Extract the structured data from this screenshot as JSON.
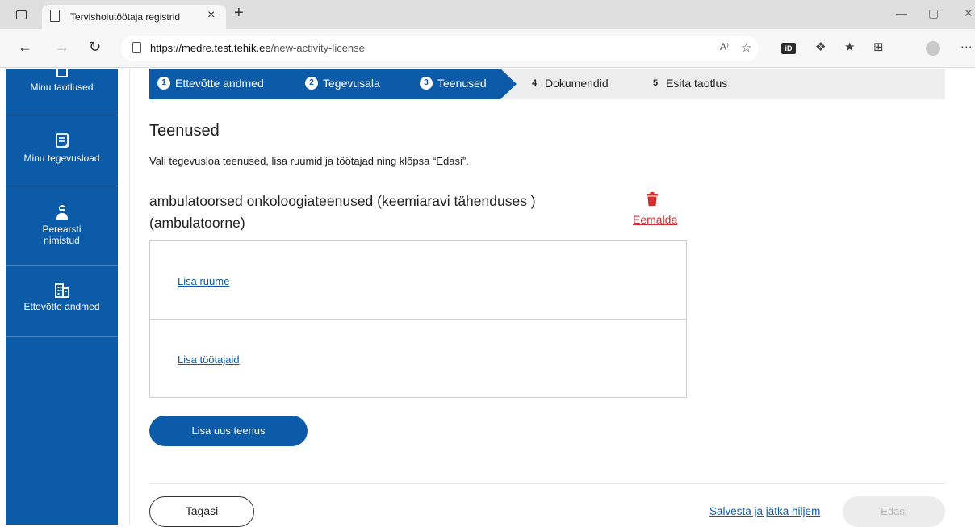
{
  "browser": {
    "tab_title": "Tervishoiutöötaja registrid",
    "tab_close": "×",
    "new_tab": "+",
    "url_host": "https://medre.test.tehik.ee",
    "url_path": "/new-activity-license",
    "window_controls": [
      "—",
      "▢",
      "✕"
    ],
    "nav_icons": [
      "arrow-left-icon",
      "arrow-right-icon",
      "refresh-icon"
    ]
  },
  "sidebar": {
    "items": [
      {
        "label": "Minu taotlused",
        "icon": "document-icon"
      },
      {
        "label": "Minu tegevusload",
        "icon": "checklist-icon"
      },
      {
        "label": "Perearsti nimistud",
        "icon": "doctor-icon"
      },
      {
        "label": "Ettevõtte andmed",
        "icon": "building-icon"
      }
    ]
  },
  "stepper": {
    "steps": [
      {
        "num": "1",
        "label": "Ettevõtte andmed",
        "state": "done"
      },
      {
        "num": "2",
        "label": "Tegevusala",
        "state": "done"
      },
      {
        "num": "3",
        "label": "Teenused",
        "state": "current"
      },
      {
        "num": "4",
        "label": "Dokumendid",
        "state": "upcoming"
      },
      {
        "num": "5",
        "label": "Esita taotlus",
        "state": "upcoming"
      }
    ],
    "active_color": "#0b5ba8"
  },
  "page": {
    "title": "Teenused",
    "intro": "Vali tegevusloa teenused, lisa ruumid ja töötajad ning klõpsa “Edasi”."
  },
  "service": {
    "name_line1": "ambulatoorsed onkoloogiateenused (keemiaravi tähenduses )",
    "name_line2": "(ambulatoorne)",
    "remove_label": "Eemalda",
    "add_rooms_label": "Lisa ruume",
    "add_staff_label": "Lisa töötajaid"
  },
  "actions": {
    "add_service_label": "Lisa uus teenus",
    "back_label": "Tagasi",
    "save_later_label": "Salvesta ja jätka hiljem",
    "next_label": "Edasi",
    "danger_color": "#d32f2f"
  }
}
